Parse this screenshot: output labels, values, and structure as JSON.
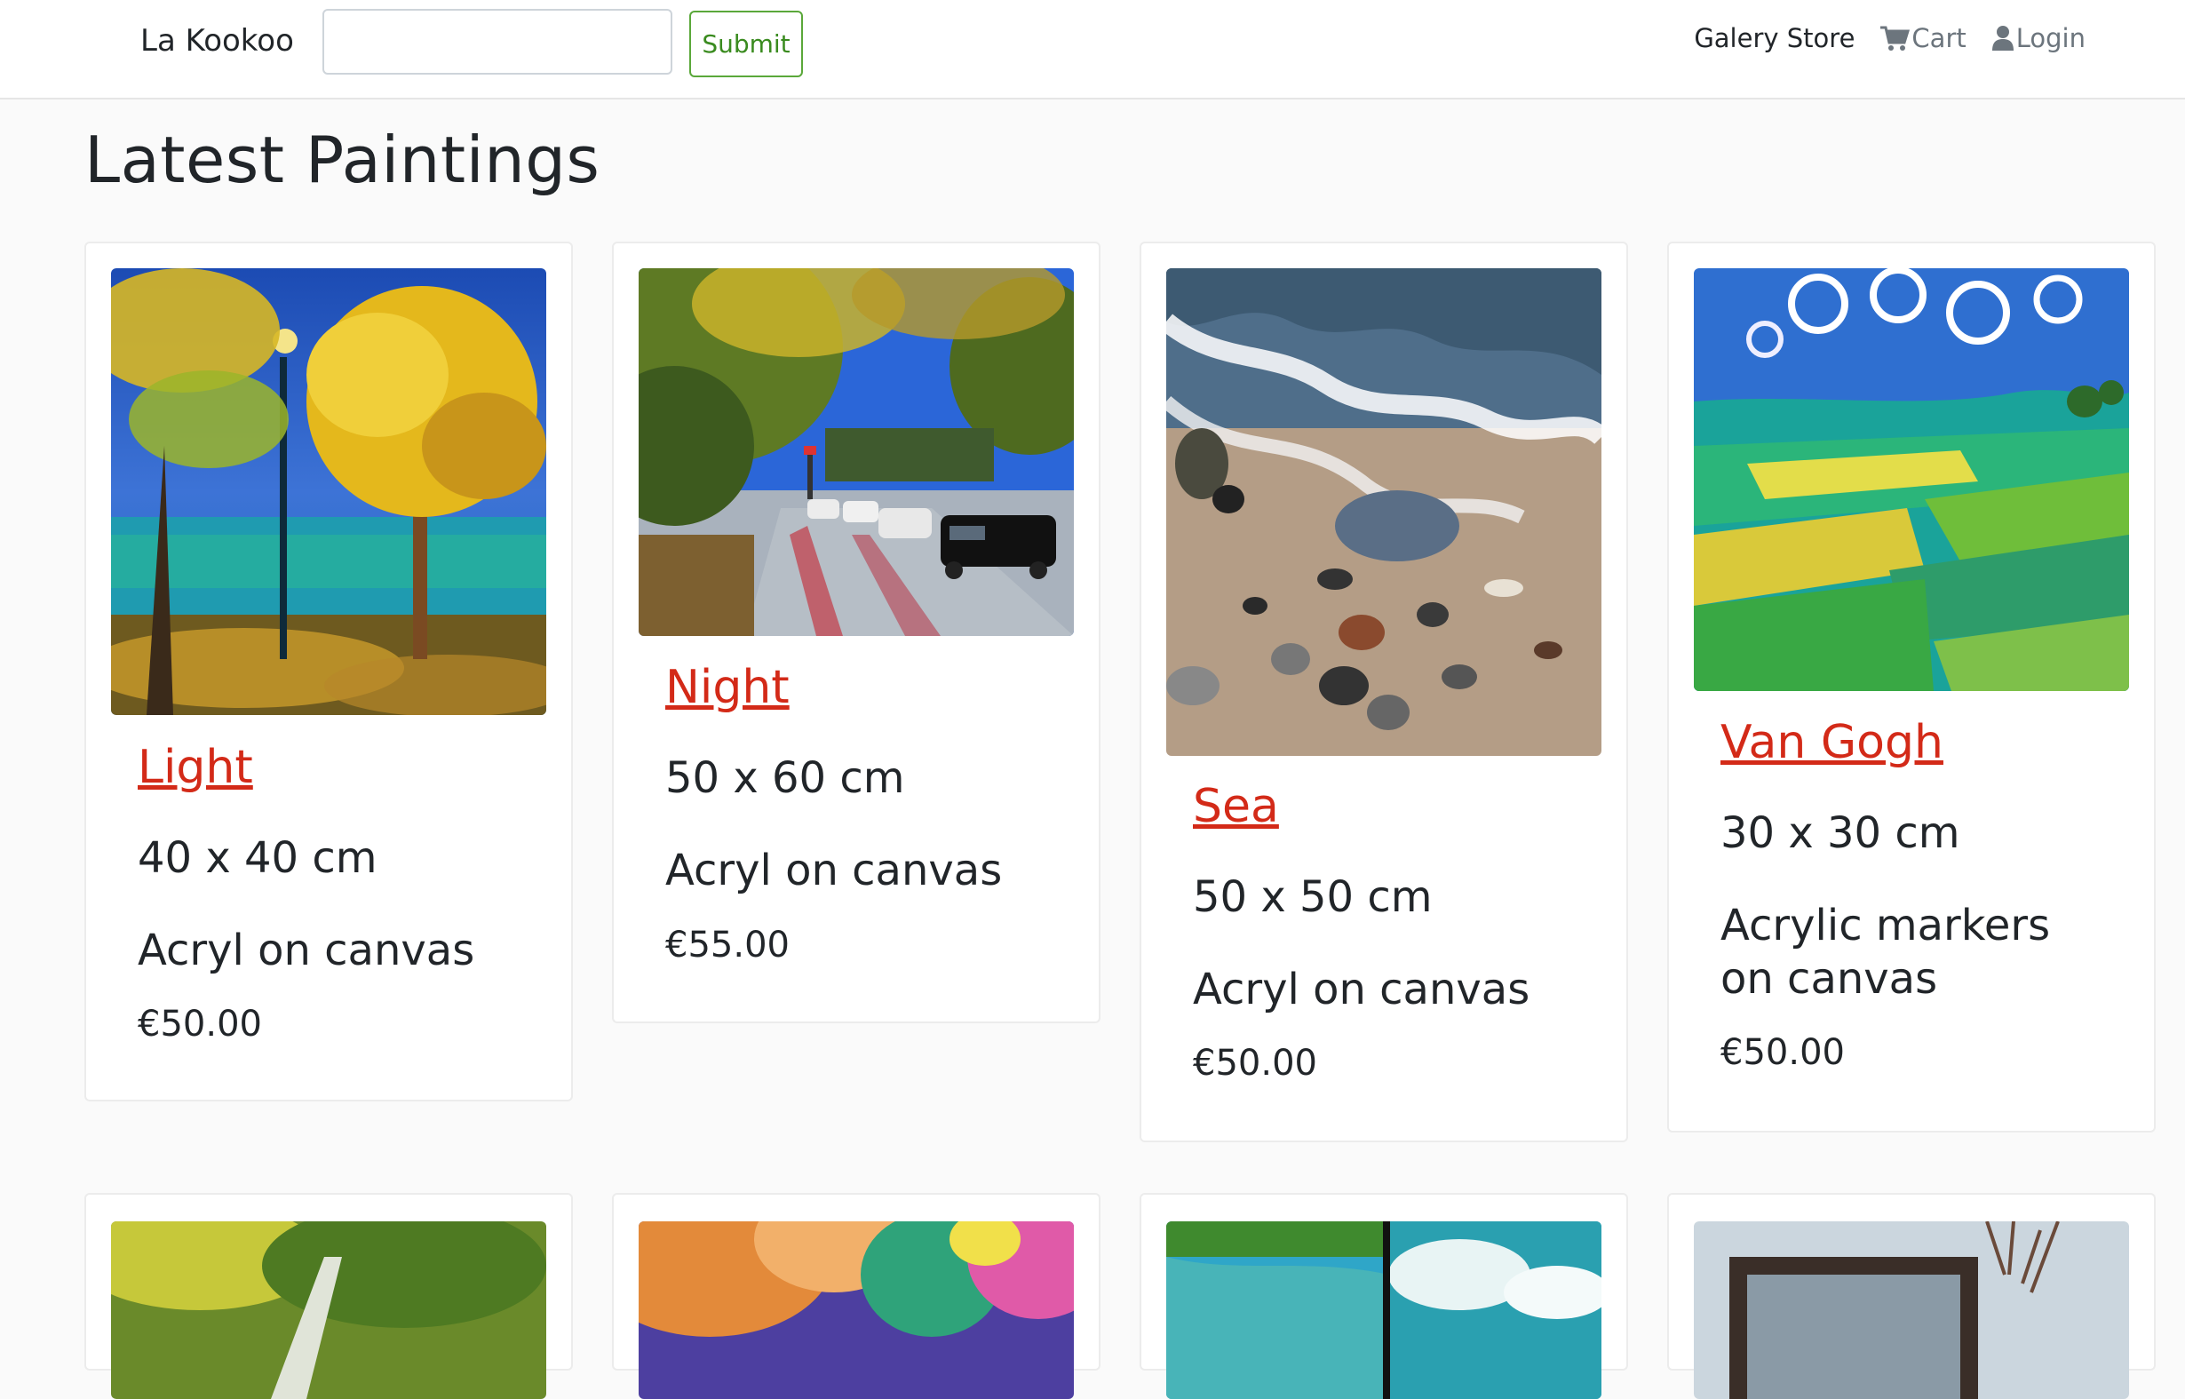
{
  "navbar": {
    "brand": "La Kookoo",
    "search_placeholder": "",
    "submit_label": "Submit",
    "store_label": "Galery Store",
    "cart_label": "Cart",
    "login_label": "Login",
    "icons": [
      "cart-icon",
      "user-icon"
    ]
  },
  "page_title": "Latest Paintings",
  "paintings": [
    {
      "title": "Light",
      "size": "40 x 40 cm",
      "medium": "Acryl on canvas",
      "price": "€50.00"
    },
    {
      "title": "Night",
      "size": "50 x 60 cm",
      "medium": "Acryl on canvas",
      "price": "€55.00"
    },
    {
      "title": "Sea",
      "size": "50 x 50 cm",
      "medium": "Acryl on canvas",
      "price": "€50.00"
    },
    {
      "title": "Van Gogh",
      "size": "30 x 30 cm",
      "medium": "Acrylic markers on canvas",
      "price": "€50.00"
    }
  ],
  "colors": {
    "link": "#d32a18",
    "submit": "#3a8b1f",
    "background": "#fafafa"
  }
}
